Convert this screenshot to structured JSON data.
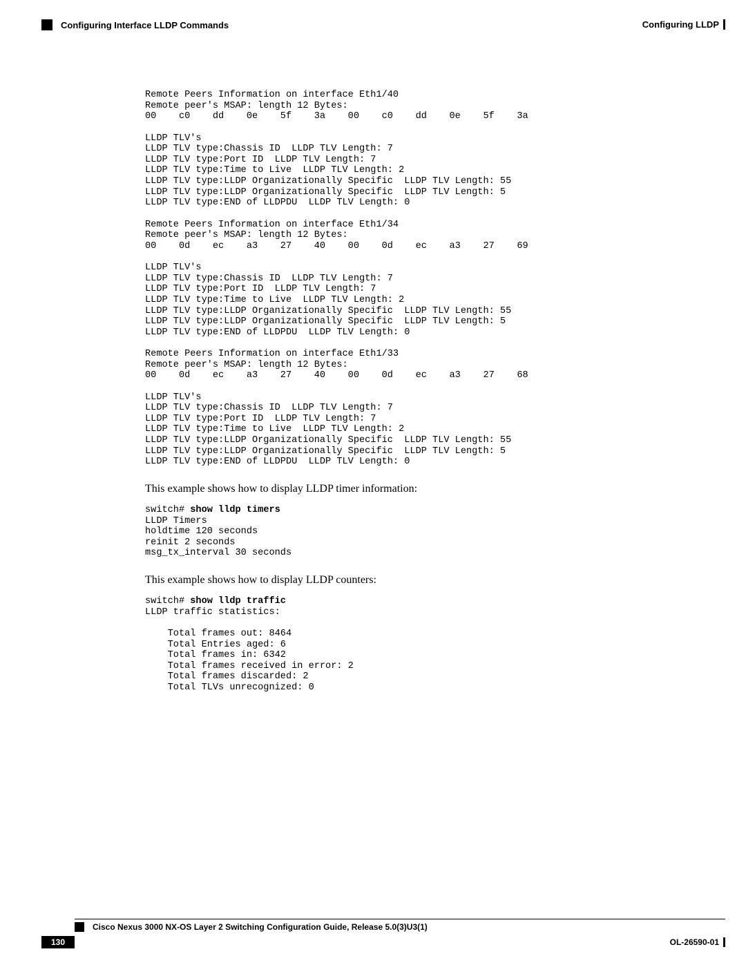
{
  "header": {
    "section": "Configuring Interface LLDP Commands",
    "chapter": "Configuring LLDP"
  },
  "block1": "Remote Peers Information on interface Eth1/40\nRemote peer's MSAP: length 12 Bytes:\n00    c0    dd    0e    5f    3a    00    c0    dd    0e    5f    3a   \n\nLLDP TLV's\nLLDP TLV type:Chassis ID  LLDP TLV Length: 7\nLLDP TLV type:Port ID  LLDP TLV Length: 7\nLLDP TLV type:Time to Live  LLDP TLV Length: 2\nLLDP TLV type:LLDP Organizationally Specific  LLDP TLV Length: 55\nLLDP TLV type:LLDP Organizationally Specific  LLDP TLV Length: 5\nLLDP TLV type:END of LLDPDU  LLDP TLV Length: 0\n\nRemote Peers Information on interface Eth1/34\nRemote peer's MSAP: length 12 Bytes:\n00    0d    ec    a3    27    40    00    0d    ec    a3    27    69   \n\nLLDP TLV's\nLLDP TLV type:Chassis ID  LLDP TLV Length: 7\nLLDP TLV type:Port ID  LLDP TLV Length: 7\nLLDP TLV type:Time to Live  LLDP TLV Length: 2\nLLDP TLV type:LLDP Organizationally Specific  LLDP TLV Length: 55\nLLDP TLV type:LLDP Organizationally Specific  LLDP TLV Length: 5\nLLDP TLV type:END of LLDPDU  LLDP TLV Length: 0\n\nRemote Peers Information on interface Eth1/33\nRemote peer's MSAP: length 12 Bytes:\n00    0d    ec    a3    27    40    00    0d    ec    a3    27    68   \n\nLLDP TLV's\nLLDP TLV type:Chassis ID  LLDP TLV Length: 7\nLLDP TLV type:Port ID  LLDP TLV Length: 7\nLLDP TLV type:Time to Live  LLDP TLV Length: 2\nLLDP TLV type:LLDP Organizationally Specific  LLDP TLV Length: 55\nLLDP TLV type:LLDP Organizationally Specific  LLDP TLV Length: 5\nLLDP TLV type:END of LLDPDU  LLDP TLV Length: 0",
  "para1": "This example shows how to display LLDP timer information:",
  "block2_prompt": "switch# ",
  "block2_cmd": "show lldp timers",
  "block2_out": "\nLLDP Timers\nholdtime 120 seconds\nreinit 2 seconds\nmsg_tx_interval 30 seconds",
  "para2": "This example shows how to display LLDP counters:",
  "block3_prompt": "switch# ",
  "block3_cmd": "show lldp traffic",
  "block3_out": "\nLLDP traffic statistics:\n\n    Total frames out: 8464\n    Total Entries aged: 6\n    Total frames in: 6342\n    Total frames received in error: 2\n    Total frames discarded: 2\n    Total TLVs unrecognized: 0",
  "footer": {
    "title": "Cisco Nexus 3000 NX-OS Layer 2 Switching Configuration Guide, Release 5.0(3)U3(1)",
    "page": "130",
    "docid": "OL-26590-01"
  }
}
